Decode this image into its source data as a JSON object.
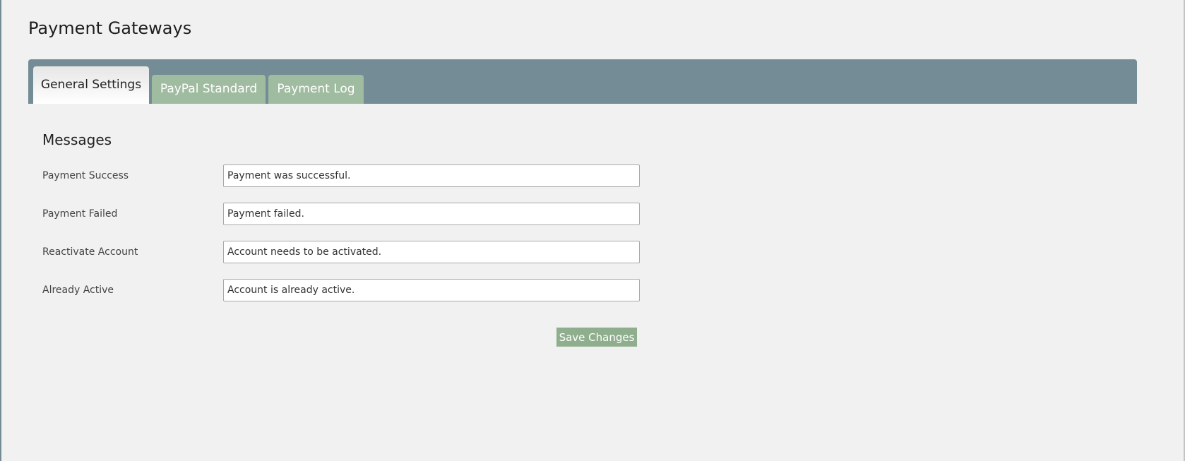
{
  "page": {
    "title": "Payment Gateways"
  },
  "tabs": [
    {
      "label": "General Settings",
      "active": true
    },
    {
      "label": "PayPal Standard",
      "active": false
    },
    {
      "label": "Payment Log",
      "active": false
    }
  ],
  "messages": {
    "section_title": "Messages",
    "fields": [
      {
        "label": "Payment Success",
        "value": "Payment was successful."
      },
      {
        "label": "Payment Failed",
        "value": "Payment failed."
      },
      {
        "label": "Reactivate Account",
        "value": "Account needs to be activated."
      },
      {
        "label": "Already Active",
        "value": "Account is already active."
      }
    ],
    "save_label": "Save Changes"
  },
  "colors": {
    "tabbar": "#748c95",
    "tab_inactive": "#9fbba0",
    "save_button": "#8fae8d",
    "background": "#f1f1f1"
  }
}
